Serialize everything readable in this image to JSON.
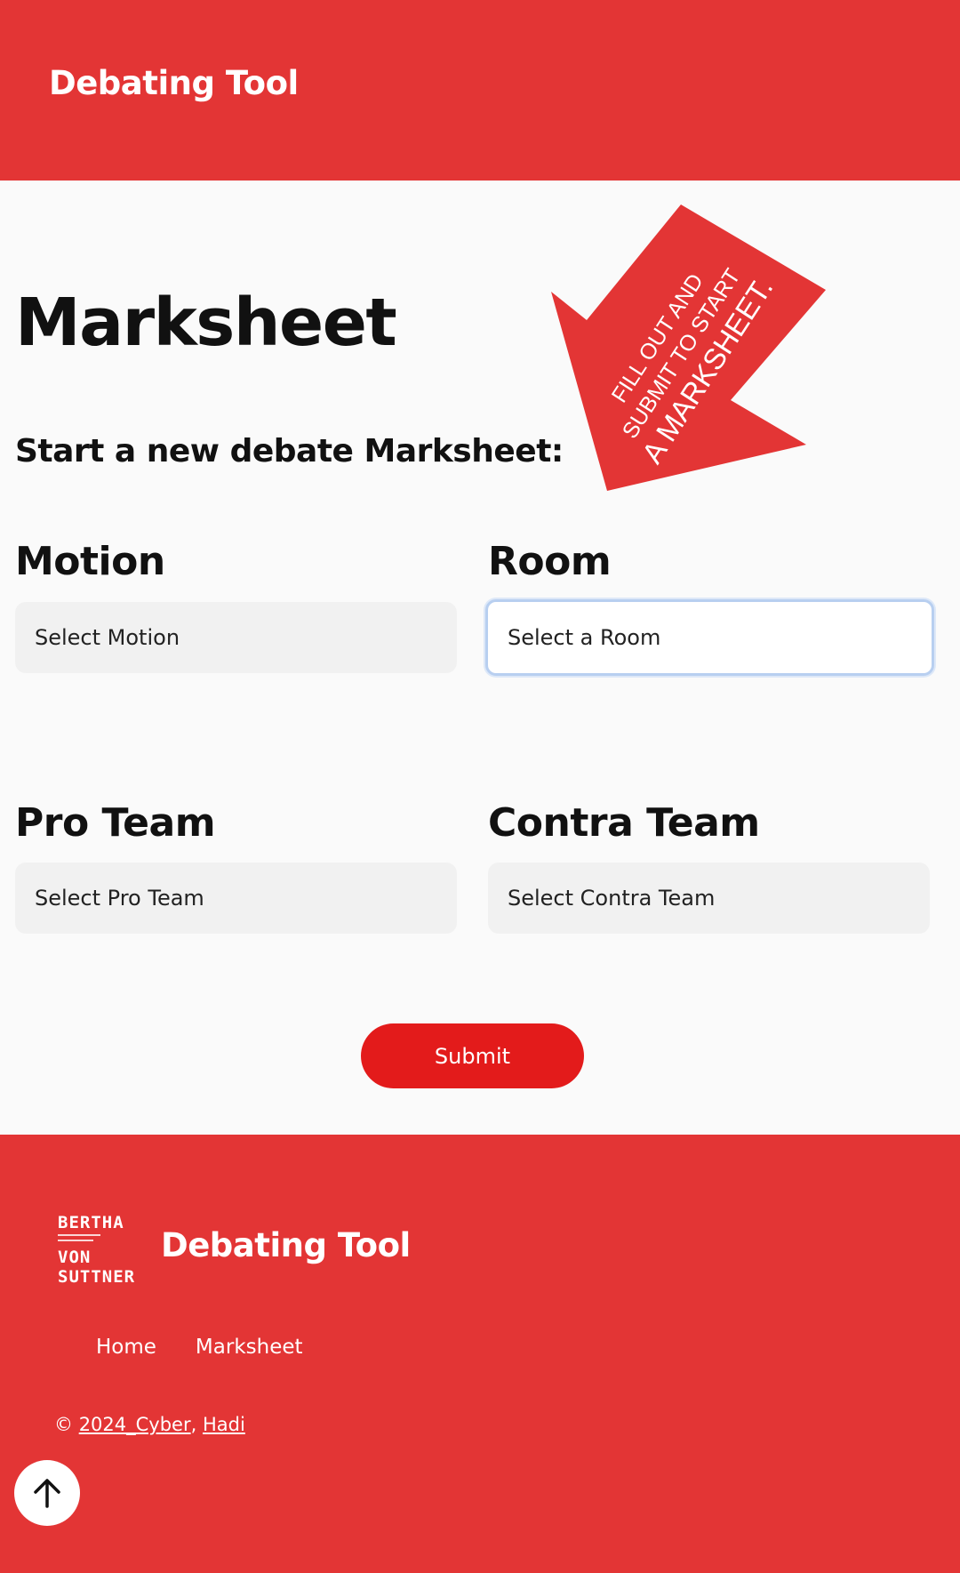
{
  "header": {
    "brand": "Debating Tool"
  },
  "main": {
    "title": "Marksheet",
    "subtitle": "Start a new debate Marksheet:",
    "callout": {
      "line1": "FILL OUT AND",
      "line2": "SUBMIT TO START",
      "line3": "A MARKSHEET."
    },
    "fields": {
      "motion": {
        "label": "Motion",
        "placeholder": "Select Motion"
      },
      "room": {
        "label": "Room",
        "placeholder": "Select a Room"
      },
      "pro_team": {
        "label": "Pro Team",
        "placeholder": "Select Pro Team"
      },
      "contra_team": {
        "label": "Contra Team",
        "placeholder": "Select Contra Team"
      }
    },
    "submit_label": "Submit"
  },
  "footer": {
    "logo": {
      "line1": "BERTHA",
      "line2": "VON",
      "line3": "SUTTNER"
    },
    "brand": "Debating Tool",
    "nav": [
      "Home",
      "Marksheet"
    ],
    "copyright_prefix": "© ",
    "copyright_link1": "2024_Cyber",
    "copyright_sep": ", ",
    "copyright_link2": "Hadi"
  },
  "colors": {
    "brand_red": "#e33535",
    "submit_red": "#e31b1b",
    "focus_border": "#b8cff0"
  },
  "icons": {
    "back_to_top": "arrow-up-icon"
  }
}
